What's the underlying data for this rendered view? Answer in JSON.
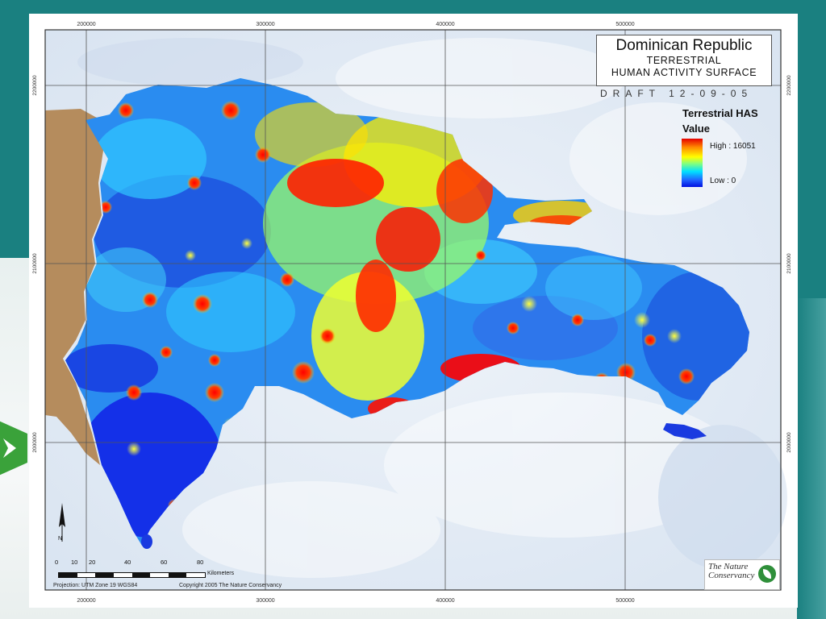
{
  "map": {
    "title": "Dominican Republic",
    "subtitle_line1": "TERRESTRIAL",
    "subtitle_line2": "HUMAN ACTIVITY SURFACE",
    "draft_stamp": "DRAFT 12-09-05",
    "legend": {
      "title_line1": "Terrestrial HAS",
      "title_line2": "Value",
      "high_label": "High : 16051",
      "low_label": "Low : 0",
      "high_value": 16051,
      "low_value": 0,
      "ramp_colors": [
        "#e60000",
        "#ff8c00",
        "#ffff00",
        "#80ff80",
        "#00e0ff",
        "#2060ff",
        "#0010e0"
      ]
    },
    "grid": {
      "x_ticks": [
        "200000",
        "300000",
        "400000",
        "500000"
      ],
      "y_ticks": [
        "2200000",
        "2100000",
        "2000000"
      ]
    },
    "scale_bar": {
      "ticks": [
        "0",
        "10",
        "20",
        "40",
        "60",
        "80"
      ],
      "unit": "Kilometers"
    },
    "projection": "Projection: UTM Zone 19 WGS84",
    "copyright": "Copyright 2005 The Nature Conservancy",
    "logo": {
      "line1": "The Nature",
      "line2": "Conservancy",
      "icon": "leaf-icon"
    },
    "north_arrow": "N",
    "colors": {
      "sea": "#dfe9f4",
      "haiti": "#b58c5d",
      "slide_bg": "#1a8080"
    }
  }
}
